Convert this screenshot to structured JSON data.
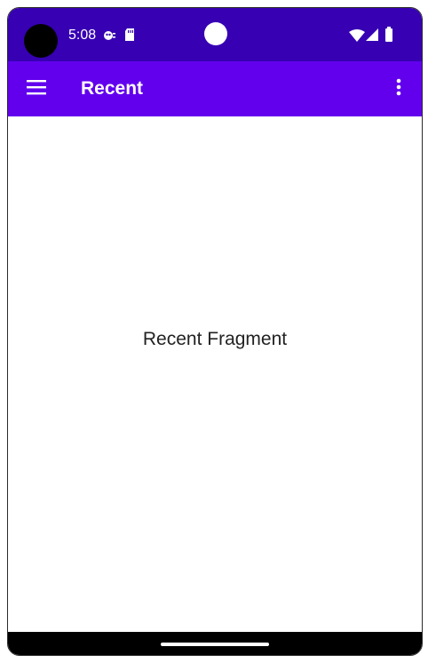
{
  "status_bar": {
    "time": "5:08",
    "left_icons": [
      "bug-notification-icon",
      "sd-card-icon"
    ],
    "right_icons": [
      "wifi-icon",
      "cell-signal-icon",
      "battery-icon"
    ]
  },
  "app_bar": {
    "title": "Recent",
    "navigation_icon": "menu-icon",
    "overflow_icon": "more-vert-icon"
  },
  "content": {
    "text": "Recent Fragment"
  },
  "colors": {
    "status_bar": "#3700b3",
    "app_bar": "#6200ee",
    "background": "#ffffff",
    "text": "#222222"
  }
}
